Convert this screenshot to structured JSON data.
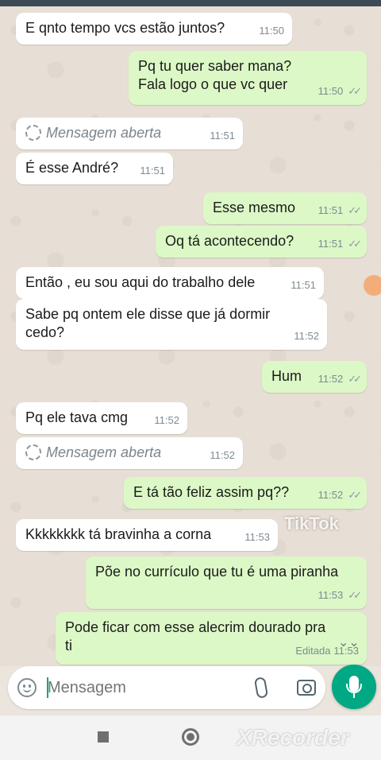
{
  "messages": [
    {
      "dir": "in",
      "text": "E qnto tempo vcs estão juntos?",
      "time": "11:50"
    },
    {
      "dir": "out",
      "text": "Pq tu quer saber mana?\nFala logo o que vc quer",
      "time": "11:50"
    },
    {
      "dir": "in",
      "view_once": true,
      "text": "Mensagem aberta",
      "time": "11:51"
    },
    {
      "dir": "in",
      "text": "É esse André?",
      "time": "11:51"
    },
    {
      "dir": "out",
      "text": "Esse mesmo",
      "time": "11:51"
    },
    {
      "dir": "out",
      "text": "Oq tá acontecendo?",
      "time": "11:51"
    },
    {
      "dir": "in",
      "text": "Então , eu sou aqui do trabalho dele",
      "time": "11:51"
    },
    {
      "dir": "in",
      "text": "Sabe pq ontem ele disse que já dormir\ncedo?",
      "time": "11:52"
    },
    {
      "dir": "out",
      "text": "Hum",
      "time": "11:52"
    },
    {
      "dir": "in",
      "text": "Pq ele tava cmg",
      "time": "11:52"
    },
    {
      "dir": "in",
      "view_once": true,
      "text": "Mensagem aberta",
      "time": "11:52"
    },
    {
      "dir": "out",
      "text": "E tá tão feliz assim pq??",
      "time": "11:52"
    },
    {
      "dir": "in",
      "text": "Kkkkkkkk tá bravinha a corna",
      "time": "11:53"
    },
    {
      "dir": "out",
      "text": "Põe no currículo que tu é uma piranha",
      "time": "11:53"
    },
    {
      "dir": "out",
      "text": "Pode ficar com esse alecrim dourado pra\nti",
      "time": "11:53",
      "edited_label": "Editada"
    }
  ],
  "input": {
    "placeholder": "Mensagem"
  },
  "watermarks": {
    "tiktok": "TikTok",
    "recorder": "XRecorder"
  },
  "colors": {
    "incoming": "#ffffff",
    "outgoing": "#dcf8c6",
    "accent": "#00a884",
    "background": "#e7ded5"
  },
  "icons": {
    "emoji": "emoji-icon",
    "attach": "paperclip-icon",
    "camera": "camera-icon",
    "mic": "microphone-icon",
    "scroll_down": "chevron-double-down-icon",
    "view_once": "view-once-icon",
    "read_receipt": "double-check-icon"
  }
}
